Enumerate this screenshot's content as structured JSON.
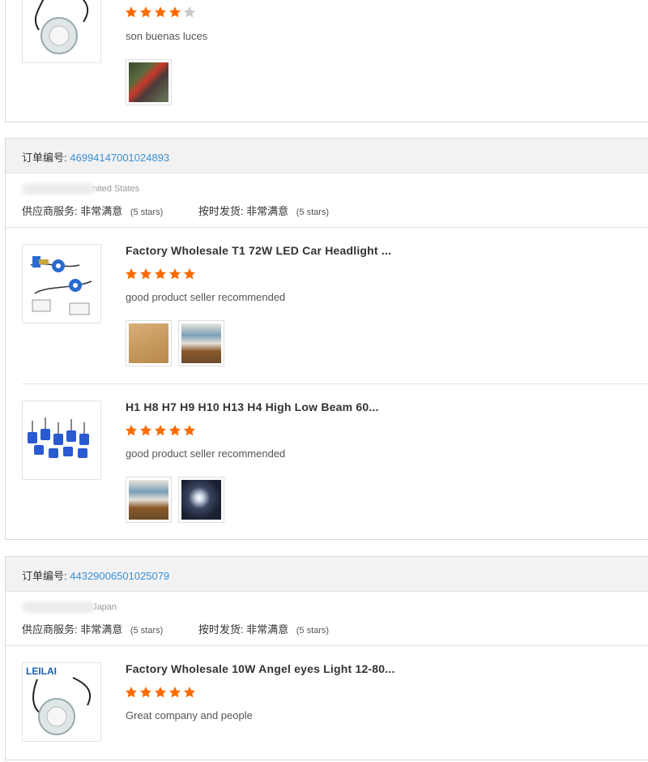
{
  "colors": {
    "accent_link": "#3b8fd4",
    "star_on": "#ff6a00",
    "star_off": "#c8c8c8"
  },
  "top_review": {
    "stars": 4,
    "comment": "son buenas luces",
    "photos": [
      "photo-red-motorcycle"
    ]
  },
  "orders": [
    {
      "order_label": "订单编号:",
      "order_number": "46994147001024893",
      "country": "nited States",
      "supplier_service_label": "供应商服务:",
      "supplier_service_value": "非常满意",
      "supplier_service_stars": "(5 stars)",
      "on_time_label": "按时发货:",
      "on_time_value": "非常满意",
      "on_time_stars": "(5 stars)",
      "items": [
        {
          "title": "Factory Wholesale T1 72W LED Car Headlight ...",
          "stars": 5,
          "comment": "good product seller recommended",
          "thumbnail": "led-headlight-kit-image",
          "photos": [
            "photo-package-box",
            "photo-product-boxes"
          ]
        },
        {
          "title": "H1 H8 H7 H9 H10 H13 H4 High Low Beam 60...",
          "stars": 5,
          "comment": "good product seller recommended",
          "thumbnail": "bulb-set-image",
          "photos": [
            "photo-product-boxes",
            "photo-car-headlight"
          ]
        }
      ]
    },
    {
      "order_label": "订单编号:",
      "order_number": "44329006501025079",
      "country": "Japan",
      "supplier_service_label": "供应商服务:",
      "supplier_service_value": "非常满意",
      "supplier_service_stars": "(5 stars)",
      "on_time_label": "按时发货:",
      "on_time_value": "非常满意",
      "on_time_stars": "(5 stars)",
      "items": [
        {
          "title": "Factory Wholesale 10W Angel eyes Light 12-80...",
          "stars": 5,
          "comment": "Great company and people",
          "thumbnail": "angel-eye-lens-image",
          "thumbnail_logo": "LEILAI",
          "photos": []
        }
      ]
    }
  ]
}
